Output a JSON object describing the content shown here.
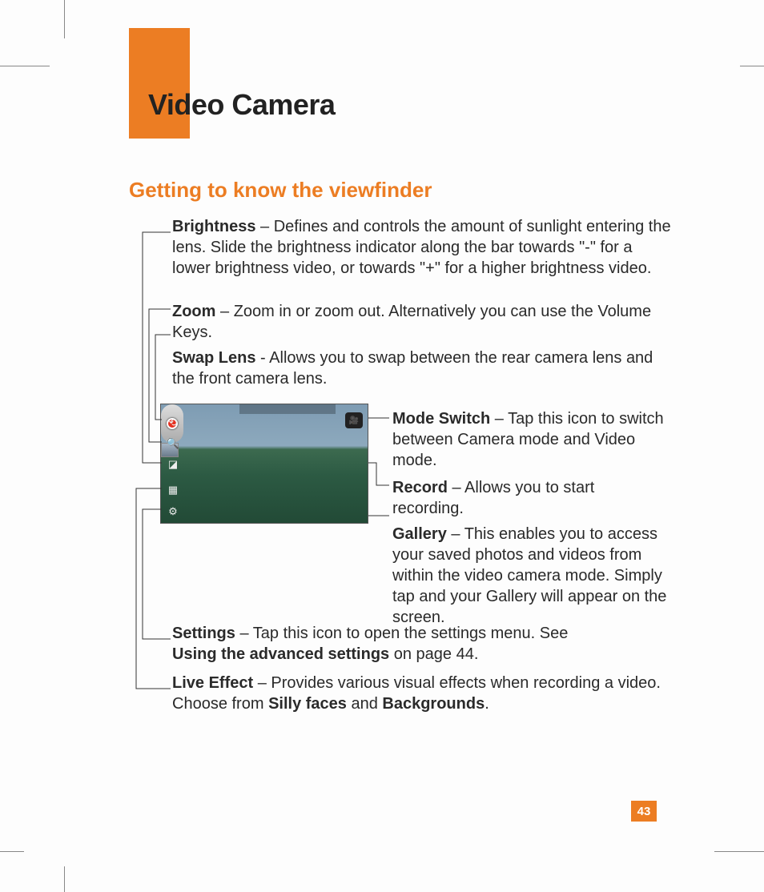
{
  "page": {
    "title": "Video Camera",
    "section": "Getting to know the viewfinder",
    "number": "43"
  },
  "items": {
    "brightness": {
      "term": "Brightness",
      "sep": " – ",
      "desc": "Defines and controls the amount of sunlight entering the lens. Slide the brightness indicator along the bar towards \"-\" for a lower brightness video, or towards \"+\" for a higher brightness video."
    },
    "zoom": {
      "term": "Zoom",
      "sep": " – ",
      "desc": "Zoom in or zoom out. Alternatively you can use the Volume Keys."
    },
    "swap": {
      "term": "Swap Lens",
      "sep": " - ",
      "desc": "Allows you to swap between the rear camera lens and the front camera lens."
    },
    "mode": {
      "term": "Mode Switch",
      "sep": " – ",
      "desc": "Tap this icon to switch between Camera mode and Video mode."
    },
    "record": {
      "term": "Record",
      "sep": " – ",
      "desc": "Allows you to start recording."
    },
    "gallery": {
      "term": "Gallery",
      "sep": " – ",
      "desc": "This enables you to access your saved photos and videos from within the video camera mode. Simply tap and your Gallery will appear on the screen."
    },
    "settings": {
      "term": "Settings",
      "sep": " – ",
      "desc_a": "Tap this icon to open the settings menu. See ",
      "bold_a": "Using the advanced settings",
      "desc_b": " on page 44."
    },
    "live": {
      "term": "Live Effect",
      "sep": " – ",
      "desc_a": "Provides various visual effects when recording a video. Choose from ",
      "bold_a": "Silly faces",
      "mid": " and ",
      "bold_b": "Backgrounds",
      "tail": "."
    }
  }
}
